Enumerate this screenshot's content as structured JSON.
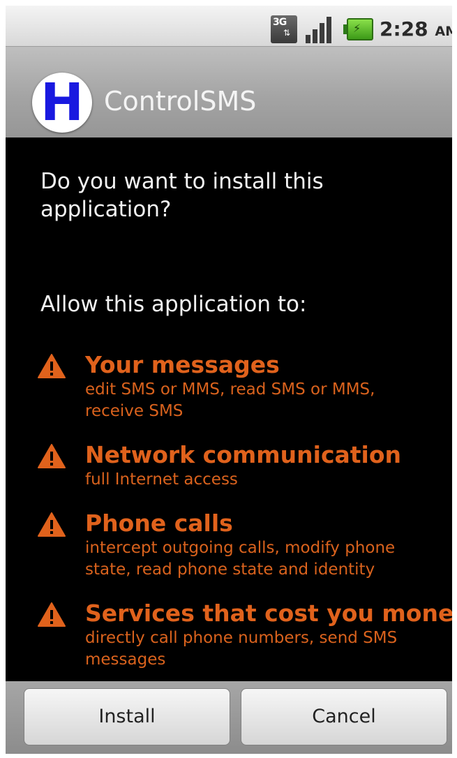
{
  "status_bar": {
    "network_label": "3G",
    "time": "2:28",
    "ampm": "AM",
    "icons": [
      "3g-data-icon",
      "signal-strength-icon",
      "battery-charging-icon"
    ]
  },
  "title_bar": {
    "app_icon_letter": "H",
    "app_name": "ControlSMS"
  },
  "prompt": {
    "question": "Do you want to install this application?",
    "allow_heading": "Allow this application to:"
  },
  "permissions": [
    {
      "title": "Your messages",
      "description": "edit SMS or MMS, read SMS or MMS, receive SMS"
    },
    {
      "title": "Network communication",
      "description": "full Internet access"
    },
    {
      "title": "Phone calls",
      "description": "intercept outgoing calls, modify phone state, read phone state and identity"
    },
    {
      "title": "Services that cost you money",
      "description": "directly call phone numbers, send SMS messages"
    }
  ],
  "buttons": {
    "install": "Install",
    "cancel": "Cancel"
  },
  "colors": {
    "warning": "#e0621c",
    "app_icon_letter": "#1919e0",
    "background": "#000000"
  }
}
